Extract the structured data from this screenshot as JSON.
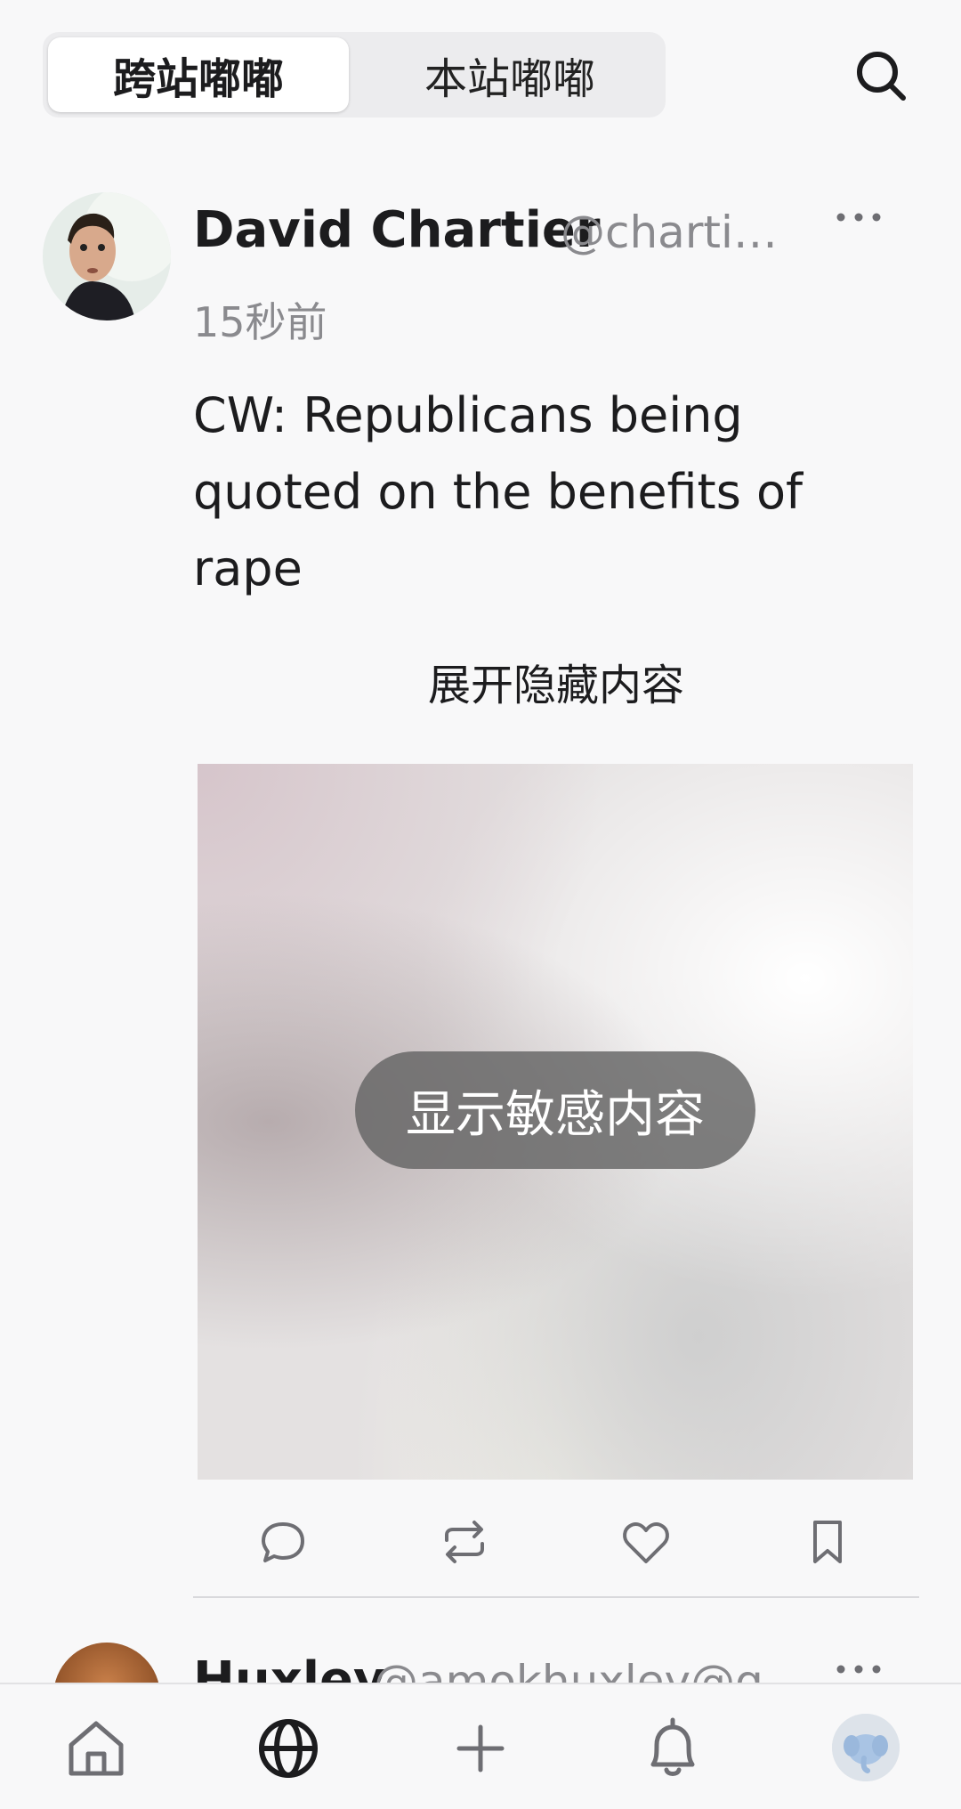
{
  "tabs": [
    {
      "label": "跨站嘟嘟",
      "active": true
    },
    {
      "label": "本站嘟嘟",
      "active": false
    }
  ],
  "post": {
    "author_name": "David Chartier",
    "author_handle": "@chartie…",
    "time": "15秒前",
    "content_warning": "CW: Republicans being quoted on the benefits of rape",
    "expand_label": "展开隐藏内容",
    "sensitive_label": "显示敏感内容"
  },
  "next_post": {
    "author_name": "Huxley",
    "author_handle": "@amokhuxley@g"
  },
  "icons": {
    "search": "search-icon",
    "more": "more-icon",
    "reply": "reply-icon",
    "boost": "boost-icon",
    "favourite": "heart-icon",
    "bookmark": "bookmark-icon",
    "nav_home": "home-icon",
    "nav_explore": "globe-icon",
    "nav_compose": "plus-icon",
    "nav_notifications": "bell-icon",
    "nav_profile": "avatar"
  },
  "colors": {
    "background": "#f8f8f9",
    "secondary_text": "#8a8a8e",
    "sensitive_overlay": "#646464"
  }
}
